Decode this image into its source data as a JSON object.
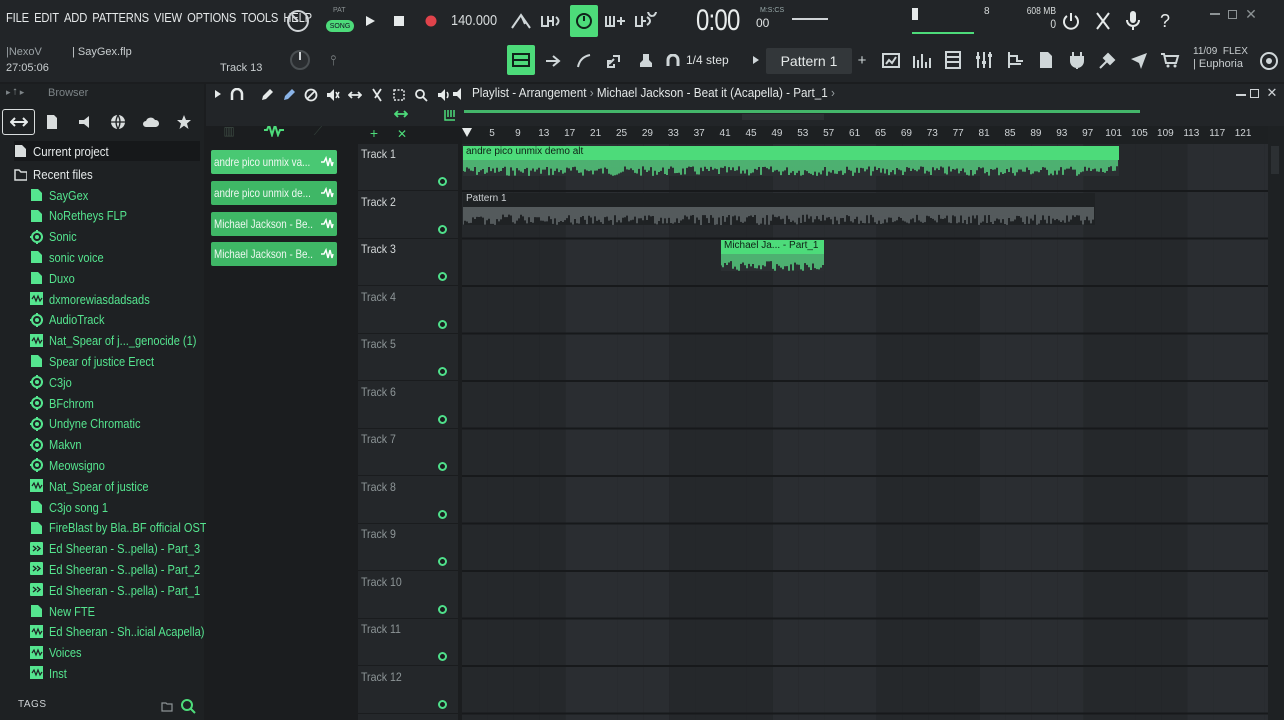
{
  "menu": [
    "FILE",
    "EDIT",
    "ADD",
    "PATTERNS",
    "VIEW",
    "OPTIONS",
    "TOOLS",
    "HELP"
  ],
  "transport": {
    "pat_label": "PAT",
    "song_label": "SONG",
    "tempo": "140.000",
    "time": "0:00",
    "time_sub": "00",
    "time_unit": "M:S:CS",
    "cpu_value": "8",
    "ram": "608 MB",
    "ram_sub": "0"
  },
  "toolbar2": {
    "snap": "1/4 step",
    "pattern": "Pattern 1",
    "date": "11/09",
    "brand": "FLEX",
    "preset": "| Euphoria"
  },
  "info": {
    "user": "|NexoV",
    "file": "| SayGex.flp",
    "clock": "27:05:06",
    "track_hint": "Track 13"
  },
  "browser": {
    "title": "Browser",
    "categories": [
      "Current project",
      "Recent files"
    ],
    "files": [
      {
        "name": "SayGex",
        "type": "file"
      },
      {
        "name": "NoRetheys FLP",
        "type": "file"
      },
      {
        "name": "Sonic",
        "type": "plugin"
      },
      {
        "name": "sonic voice",
        "type": "file"
      },
      {
        "name": "Duxo",
        "type": "file"
      },
      {
        "name": "dxmorewiasdadsads",
        "type": "audio"
      },
      {
        "name": "AudioTrack",
        "type": "plugin"
      },
      {
        "name": "Nat_Spear of j..._genocide (1)",
        "type": "audio"
      },
      {
        "name": "Spear of justice Erect",
        "type": "file"
      },
      {
        "name": "C3jo",
        "type": "plugin"
      },
      {
        "name": "BFchrom",
        "type": "plugin"
      },
      {
        "name": "Undyne Chromatic",
        "type": "plugin"
      },
      {
        "name": "Makvn",
        "type": "plugin"
      },
      {
        "name": "Meowsigno",
        "type": "plugin"
      },
      {
        "name": "Nat_Spear of justice",
        "type": "audio"
      },
      {
        "name": "C3jo song 1",
        "type": "file"
      },
      {
        "name": "FireBlast by Bla..BF official OST",
        "type": "file"
      },
      {
        "name": "Ed Sheeran - S..pella) - Part_3",
        "type": "clip"
      },
      {
        "name": "Ed Sheeran - S..pella) - Part_2",
        "type": "clip"
      },
      {
        "name": "Ed Sheeran - S..pella) - Part_1",
        "type": "clip"
      },
      {
        "name": "New FTE",
        "type": "file"
      },
      {
        "name": "Ed Sheeran - Sh..icial Acapella)",
        "type": "audio"
      },
      {
        "name": "Voices",
        "type": "audio"
      },
      {
        "name": "Inst",
        "type": "audio"
      }
    ],
    "tags": "TAGS"
  },
  "picker": [
    "andre pico unmix va...",
    "andre pico unmix de...",
    "Michael Jackson - Be...",
    "Michael Jackson - Be..."
  ],
  "playlist": {
    "title": "Playlist - Arrangement",
    "breadcrumb": "Michael Jackson - Beat it  (Acapella) - Part_1",
    "ruler": [
      "5",
      "9",
      "13",
      "17",
      "21",
      "25",
      "29",
      "33",
      "37",
      "41",
      "45",
      "49",
      "53",
      "57",
      "61",
      "65",
      "69",
      "73",
      "77",
      "81",
      "85",
      "89",
      "93",
      "97",
      "101",
      "105",
      "109",
      "113",
      "117",
      "121"
    ],
    "tracks": [
      "Track 1",
      "Track 2",
      "Track 3",
      "Track 4",
      "Track 5",
      "Track 6",
      "Track 7",
      "Track 8",
      "Track 9",
      "Track 10",
      "Track 11",
      "Track 12"
    ],
    "clips": {
      "c1": "andre pico unmix demo alt",
      "c2": "Pattern 1",
      "c3": "Michael Ja... - Part_1"
    }
  },
  "colors": {
    "accent": "#4ddb7a",
    "clip_green": "#5ce88c",
    "bg": "#1b1d1f"
  }
}
